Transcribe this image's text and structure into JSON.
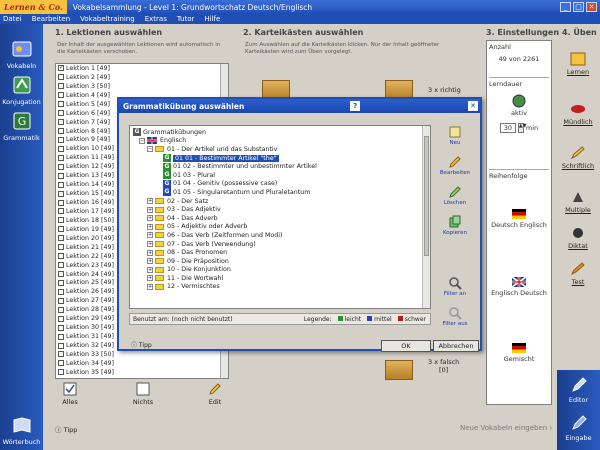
{
  "window": {
    "logo": "Lernen & Co.",
    "title": "Vokabelsammlung - Level 1: Grundwortschatz Deutsch/Englisch",
    "btn_min": "_",
    "btn_max": "□",
    "btn_close": "✕"
  },
  "menu": [
    "Datei",
    "Bearbeiten",
    "Vokabeltraining",
    "Extras",
    "Tutor",
    "Hilfe"
  ],
  "leftnav": [
    {
      "label": "Vokabeln",
      "icon": "vocab-icon"
    },
    {
      "label": "Konjugation",
      "icon": "conjugation-icon"
    },
    {
      "label": "Grammatik",
      "icon": "grammar-icon"
    },
    {
      "label": "Wörterbuch",
      "icon": "dictionary-icon"
    }
  ],
  "columns": {
    "c1": "1. Lektionen auswählen",
    "c2": "2. Karteikästen auswählen",
    "c3": "3. Einstellungen",
    "c4": "4. Üben"
  },
  "c1_info": "Der Inhalt der ausgewählten Lektionen wird automatisch in die Karteikästen verschoben.",
  "c2_info": "Zum Auswählen auf die Karteikästen klicken. Nur der Inhalt geöffneter Karteikästen wird zum Üben vorgelegt.",
  "lessons": [
    {
      "label": "Lektion 1 [49]",
      "checked": "✓"
    },
    {
      "label": "Lektion 2 [49]",
      "checked": ""
    },
    {
      "label": "Lektion 3 [50]",
      "checked": ""
    },
    {
      "label": "Lektion 4 [49]",
      "checked": ""
    },
    {
      "label": "Lektion 5 [49]",
      "checked": ""
    },
    {
      "label": "Lektion 6 [49]",
      "checked": ""
    },
    {
      "label": "Lektion 7 [49]",
      "checked": ""
    },
    {
      "label": "Lektion 8 [49]",
      "checked": ""
    },
    {
      "label": "Lektion 9 [49]",
      "checked": ""
    },
    {
      "label": "Lektion 10 [49]",
      "checked": ""
    },
    {
      "label": "Lektion 11 [49]",
      "checked": ""
    },
    {
      "label": "Lektion 12 [49]",
      "checked": ""
    },
    {
      "label": "Lektion 13 [49]",
      "checked": ""
    },
    {
      "label": "Lektion 14 [49]",
      "checked": ""
    },
    {
      "label": "Lektion 15 [49]",
      "checked": ""
    },
    {
      "label": "Lektion 16 [49]",
      "checked": ""
    },
    {
      "label": "Lektion 17 [49]",
      "checked": ""
    },
    {
      "label": "Lektion 18 [50]",
      "checked": ""
    },
    {
      "label": "Lektion 19 [49]",
      "checked": ""
    },
    {
      "label": "Lektion 20 [49]",
      "checked": ""
    },
    {
      "label": "Lektion 21 [49]",
      "checked": ""
    },
    {
      "label": "Lektion 22 [49]",
      "checked": ""
    },
    {
      "label": "Lektion 23 [49]",
      "checked": ""
    },
    {
      "label": "Lektion 24 [49]",
      "checked": ""
    },
    {
      "label": "Lektion 25 [49]",
      "checked": ""
    },
    {
      "label": "Lektion 26 [49]",
      "checked": ""
    },
    {
      "label": "Lektion 27 [49]",
      "checked": ""
    },
    {
      "label": "Lektion 28 [49]",
      "checked": ""
    },
    {
      "label": "Lektion 29 [49]",
      "checked": ""
    },
    {
      "label": "Lektion 30 [49]",
      "checked": ""
    },
    {
      "label": "Lektion 31 [49]",
      "checked": ""
    },
    {
      "label": "Lektion 32 [49]",
      "checked": ""
    },
    {
      "label": "Lektion 33 [50]",
      "checked": ""
    },
    {
      "label": "Lektion 34 [49]",
      "checked": ""
    },
    {
      "label": "Lektion 35 [49]",
      "checked": ""
    }
  ],
  "list_buttons": {
    "all": "Alles",
    "none": "Nichts",
    "edit": "Edit"
  },
  "boxes": {
    "top_count": "3 x richtig",
    "bottom_count": "3 x falsch",
    "bottom_num": "[0]"
  },
  "settings": {
    "anzahl_label": "Anzahl",
    "anzahl_value": "49 von 2261",
    "lerndauer_label": "Lerndauer",
    "aktiv_label": "aktiv",
    "minutes": "30",
    "min_label": "min",
    "reihenfolge_label": "Reihenfolge",
    "order": [
      "Deutsch Englisch",
      "Englisch Deutsch",
      "Gemischt"
    ]
  },
  "modes": [
    "Lernen",
    "Mündlich",
    "Schriftlich",
    "Multiple",
    "Diktat",
    "Test"
  ],
  "bottom": {
    "tip": "Tipp",
    "new_vocab": "Neue Vokabeln eingeben ›"
  },
  "rightnav": [
    {
      "label": "Editor",
      "icon": "editor-icon"
    },
    {
      "label": "Eingabe",
      "icon": "input-icon"
    }
  ],
  "dialog": {
    "title": "Grammatikübung auswählen",
    "help": "?",
    "close": "✕",
    "tree": {
      "root": "Grammatikübungen",
      "lang": "Englisch",
      "ch1": "01 - Der Artikel und das Substantiv",
      "ch1_items": [
        {
          "label": "01 01 - Bestimmter Artikel \"the\"",
          "icon": "G",
          "color": "#2d8f2d",
          "selected": true
        },
        {
          "label": "01 02 - Bestimmter und unbestimmter Artikel",
          "icon": "G",
          "color": "#2d8f2d",
          "selected": false
        },
        {
          "label": "01 03 - Plural",
          "icon": "G",
          "color": "#2d8f2d",
          "selected": false
        },
        {
          "label": "01 04 - Genitiv (possessive case)",
          "icon": "G",
          "color": "#2347b8",
          "selected": false
        },
        {
          "label": "01 05 - Singularetantum und Pluraletantum",
          "icon": "G",
          "color": "#2347b8",
          "selected": false
        }
      ],
      "chapters": [
        "02 - Der Satz",
        "03 - Das Adjektiv",
        "04 - Das Adverb",
        "05 - Adjektiv oder Adverb",
        "06 - Das Verb (Zeitformen und Modi)",
        "07 - Das Verb (Verwendung)",
        "08 - Das Pronomen",
        "09 - Die Präposition",
        "10 - Die Konjunktion",
        "11 - Die Wortwahl",
        "12 - Vermischtes"
      ]
    },
    "tools": [
      "Neu",
      "Bearbeiten",
      "Löschen",
      "Kopieren"
    ],
    "filter_on": "Filter an",
    "filter_off": "Filter aus",
    "status_used": "Benutzt am: (noch nicht benutzt)",
    "legend_label": "Legende:",
    "legend": [
      {
        "label": "leicht",
        "color": "#2d8f2d"
      },
      {
        "label": "mittel",
        "color": "#2347b8"
      },
      {
        "label": "schwer",
        "color": "#b01d1d"
      }
    ],
    "tip": "Tipp",
    "ok": "OK",
    "cancel": "Abbrechen"
  }
}
